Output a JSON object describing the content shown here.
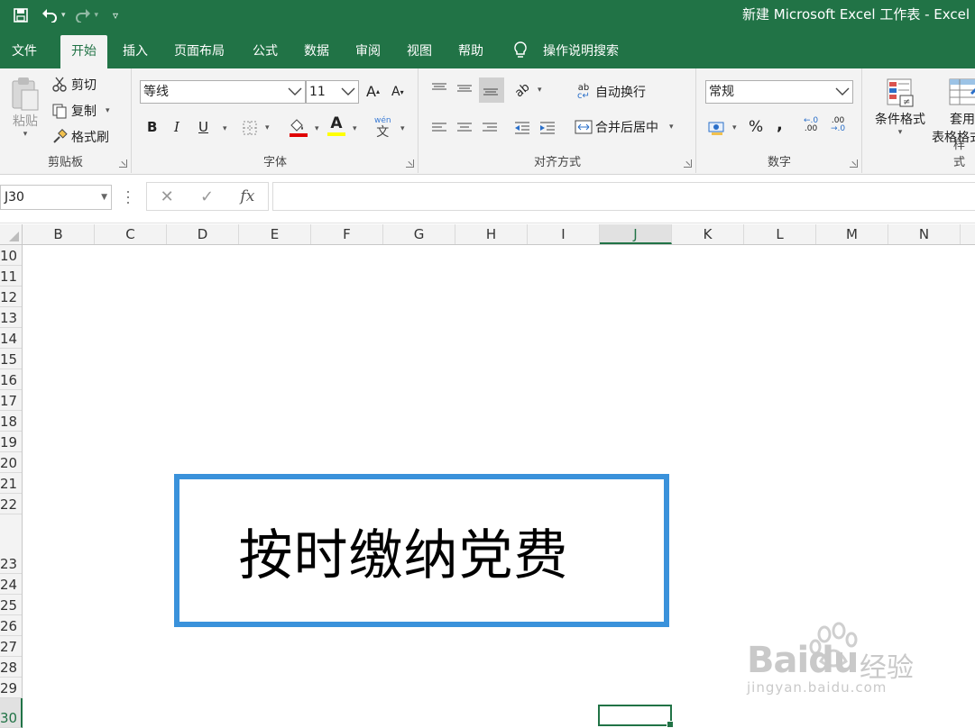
{
  "window": {
    "title": "新建 Microsoft Excel 工作表  -  Excel"
  },
  "tabs": [
    {
      "label": "文件"
    },
    {
      "label": "开始"
    },
    {
      "label": "插入"
    },
    {
      "label": "页面布局"
    },
    {
      "label": "公式"
    },
    {
      "label": "数据"
    },
    {
      "label": "审阅"
    },
    {
      "label": "视图"
    },
    {
      "label": "帮助"
    }
  ],
  "tell_me": "操作说明搜索",
  "ribbon": {
    "clipboard": {
      "label": "剪贴板",
      "paste": "粘贴",
      "cut": "剪切",
      "copy": "复制",
      "format_painter": "格式刷"
    },
    "font": {
      "label": "字体",
      "font_name": "等线",
      "font_size": "11",
      "bold": "B",
      "italic": "I",
      "underline": "U",
      "phonetic": "wén"
    },
    "alignment": {
      "label": "对齐方式",
      "wrap_text": "自动换行",
      "merge_center": "合并后居中"
    },
    "number": {
      "label": "数字",
      "format": "常规",
      "percent": "%",
      "comma": ","
    },
    "styles": {
      "label": "样式",
      "conditional_formatting": "条件格式",
      "format_as_table_1": "套用",
      "format_as_table_2": "表格格式"
    }
  },
  "formula_bar": {
    "name_box": "J30",
    "value": ""
  },
  "columns": [
    "B",
    "C",
    "D",
    "E",
    "F",
    "G",
    "H",
    "I",
    "J",
    "K",
    "L",
    "M",
    "N"
  ],
  "selected_column": "J",
  "rows": [
    "10",
    "11",
    "12",
    "13",
    "14",
    "15",
    "16",
    "17",
    "18",
    "19",
    "20",
    "21",
    "22",
    "23",
    "24",
    "25",
    "26",
    "27",
    "28",
    "29",
    "30"
  ],
  "selected_row": "30",
  "textbox": {
    "text": "按时缴纳党费",
    "border_color": "#3a92db"
  },
  "watermark": {
    "logo": "Baidu",
    "suffix": "经验",
    "url": "jingyan.baidu.com"
  },
  "colors": {
    "accent": "#217346"
  }
}
